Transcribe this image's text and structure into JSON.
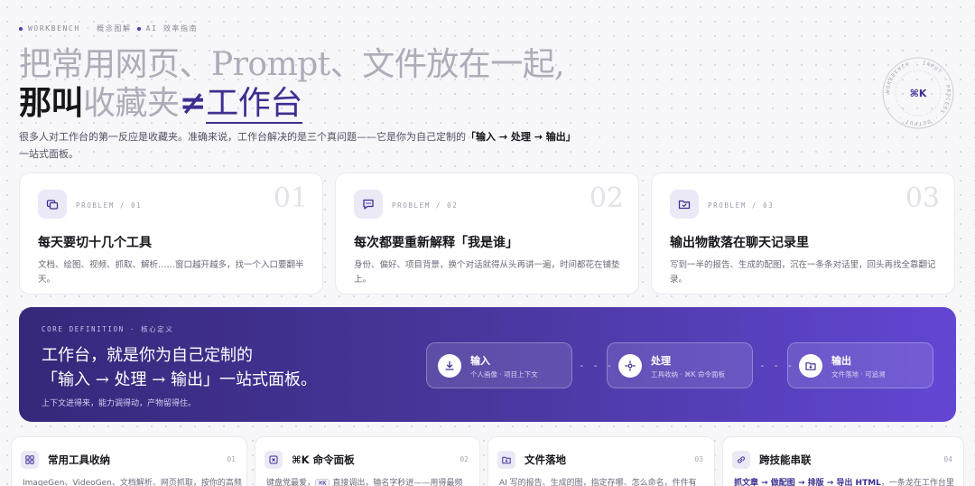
{
  "eyebrow": {
    "brand": "WORKBENCH",
    "sep": "·",
    "part2": "概念图解",
    "part3": "AI 效率指南"
  },
  "headline": {
    "line1": "把常用网页、Prompt、文件放在一起,",
    "line2_dark": "那叫",
    "line2_grey": "收藏夹",
    "line2_neq": "≠",
    "line2_accent": "工作台"
  },
  "seal": {
    "ring_text": "WORKBENCH · INPUT · PROCESS · OUTPUT · ",
    "center": "⌘K"
  },
  "intro": {
    "text": "很多人对工作台的第一反应是收藏夹。准确来说，工作台解决的是三个真问题——它是你为自己定制的",
    "bold": "「输入 → 处理 → 输出」",
    "tail": "一站式面板。"
  },
  "problems": [
    {
      "icon": "windows-icon",
      "tag": "PROBLEM / 01",
      "num": "01",
      "title": "每天要切十几个工具",
      "desc": "文档、绘图、视频、抓取、解析……窗口越开越多，找一个入口要翻半天。"
    },
    {
      "icon": "chat-icon",
      "tag": "PROBLEM / 02",
      "num": "02",
      "title": "每次都要重新解释「我是谁」",
      "desc": "身份、偏好、项目背景，换个对话就得从头再讲一遍，时间都花在铺垫上。"
    },
    {
      "icon": "folder-check-icon",
      "tag": "PROBLEM / 03",
      "num": "03",
      "title": "输出物散落在聊天记录里",
      "desc": "写到一半的报告、生成的配图，沉在一条条对话里，回头再找全靠翻记录。"
    }
  ],
  "banner": {
    "tag": "CORE DEFINITION · 核心定义",
    "title1": "工作台，就是你为自己定制的",
    "title2": "「输入 → 处理 → 输出」一站式面板。",
    "sub": "上下文进得来，能力调得动，产物留得住。",
    "arrow": "- - - ›",
    "steps": [
      {
        "label": "输入",
        "sub": "个人画像 · 项目上下文",
        "icon": "download-icon"
      },
      {
        "label": "处理",
        "sub": "工具收纳 · ⌘K 命令面板",
        "icon": "sparkle-icon"
      },
      {
        "label": "输出",
        "sub": "文件落地 · 可追溯",
        "icon": "folder-in-icon"
      }
    ]
  },
  "features": [
    {
      "icon": "grid-icon",
      "title": "常用工具收纳",
      "num": "01",
      "desc": "ImageGen、VideoGen、文档解析、网页抓取，按你的高频"
    },
    {
      "icon": "command-icon",
      "title": "⌘K 命令面板",
      "num": "02",
      "desc_pre": "键盘党最爱，",
      "kbd": "⌘K",
      "desc_post": " 直接调出，输名字秒进——用得最频"
    },
    {
      "icon": "folder-icon",
      "title": "文件落地",
      "num": "03",
      "desc": "AI 写的报告、生成的图，指定存哪、怎么命名，件件有"
    },
    {
      "icon": "link-icon",
      "title": "跨技能串联",
      "num": "04",
      "desc_bold": "抓文章 → 做配图 → 排版 → 导出 HTML",
      "desc_post": "，一条龙在工作台里"
    }
  ],
  "colors": {
    "accent": "#3d2f91",
    "banner_start": "#35287a",
    "banner_end": "#6346d3"
  }
}
